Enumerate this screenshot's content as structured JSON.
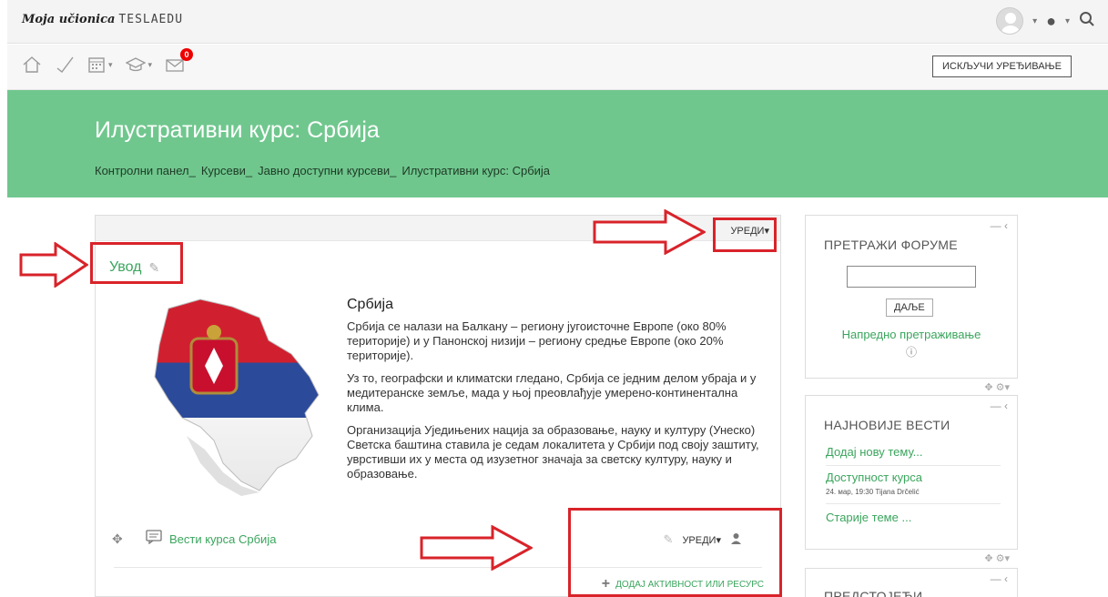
{
  "topbar": {
    "brand_italic": "Moja učionica",
    "brand_logo": "TESLAEDU",
    "icons": [
      "avatar",
      "globe-icon",
      "search-icon"
    ]
  },
  "toolbar": {
    "icons": [
      "home-icon",
      "check-icon",
      "calendar-icon",
      "graduation-cap-icon",
      "mail-icon"
    ],
    "mail_badge": "0",
    "edit_mode_button": "ИСКЉУЧИ УРЕЂИВАЊЕ"
  },
  "header": {
    "title": "Илустративни курс: Србија",
    "breadcrumb": [
      "Контролни панел",
      "Курсеви",
      "Јавно доступни курсеви",
      "Илустративни курс: Србија"
    ]
  },
  "main": {
    "edit_label": "УРЕДИ",
    "section_title": "Увод",
    "content_heading": "Србија",
    "paragraphs": [
      "Србија се налази на Балкану – региону југоисточне Европе (око 80% територије) и у Панонској низији – региону средње Европе (око 20% територије).",
      "Уз то, географски и климатски гледано, Србија се једним делом убраја и у медитеранске земље, мада у њој преовлађује умерено-континентална клима.",
      "Организација Уједињених нација за образовање, науку и културу (Унеско) Светска баштина ставила је седам локалитета у Србији под своју заштиту, уврстивши их у места од изузетног значаја за светску културу, науку и образовање."
    ],
    "activity_name": "Вести курса Србија",
    "activity_edit": "УРЕДИ",
    "add_activity": "ДОДАЈ АКТИВНОСТ ИЛИ РЕСУРС"
  },
  "sidebar": {
    "search_forums": {
      "title": "ПРЕТРАЖИ ФОРУМЕ",
      "button": "ДАЉЕ",
      "advanced": "Напредно претраживање"
    },
    "latest_news": {
      "title": "НАЈНОВИЈЕ ВЕСТИ",
      "add_topic": "Додај нову тему...",
      "item_title": "Доступност курса",
      "item_meta": "24. мар, 19:30  Tijana Drčelić",
      "older": "Старије теме ..."
    },
    "upcoming": {
      "title": "ПРЕДСТОЈЕЋИ"
    }
  },
  "colors": {
    "header_bg": "#70c78e",
    "link_green": "#3aa55d",
    "annotation_red": "#d9232a",
    "badge_red": "#ee0000"
  }
}
